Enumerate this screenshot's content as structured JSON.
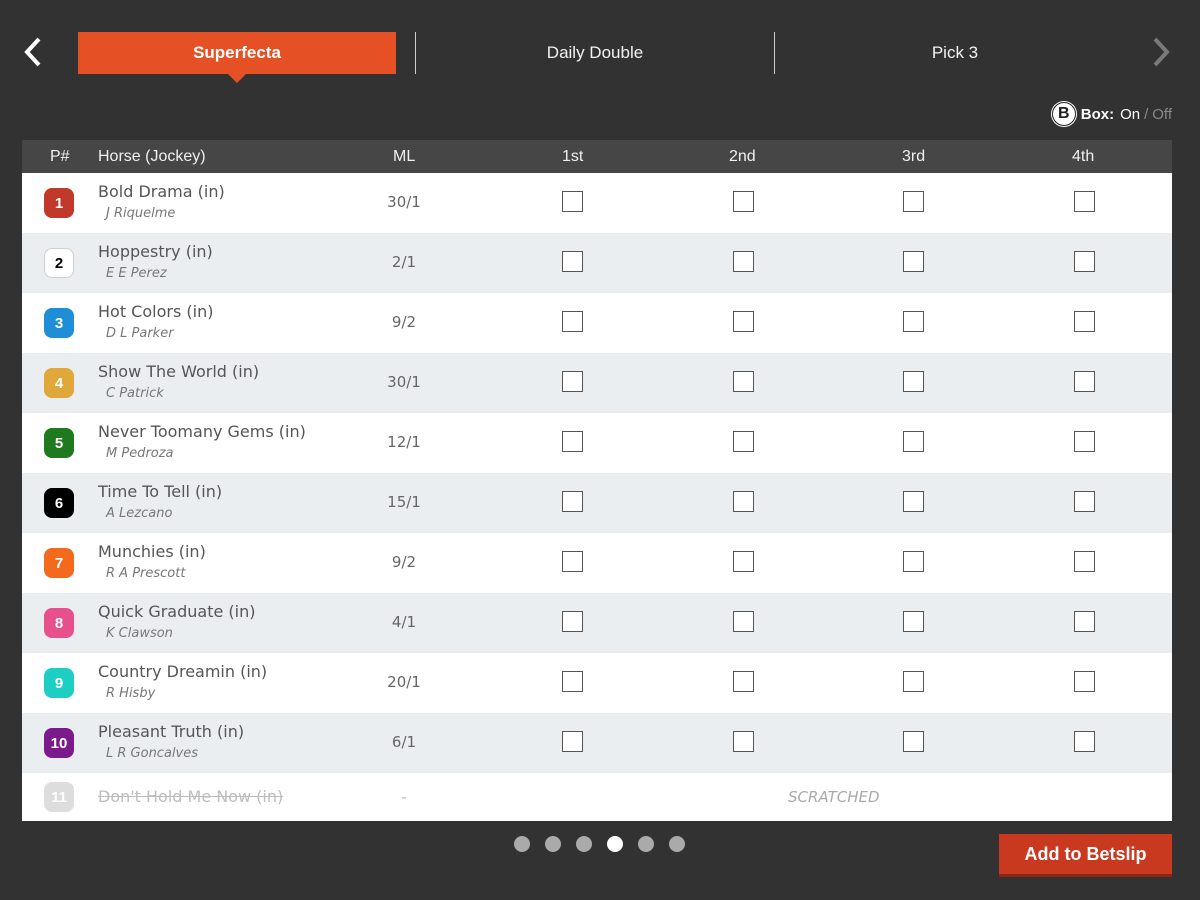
{
  "nav": {
    "tabs": [
      {
        "label": "Superfecta",
        "active": true
      },
      {
        "label": "Daily Double",
        "active": false
      },
      {
        "label": "Pick 3",
        "active": false
      }
    ],
    "prev_icon": "chevron-left-icon",
    "next_icon": "chevron-right-icon"
  },
  "box_toggle": {
    "badge": "B",
    "label": "Box:",
    "on": "On",
    "separator": "/",
    "off": "Off",
    "state": "On"
  },
  "table": {
    "headers": {
      "pnum": "P#",
      "horse": "Horse (Jockey)",
      "ml": "ML",
      "first": "1st",
      "second": "2nd",
      "third": "3rd",
      "fourth": "4th"
    },
    "rows": [
      {
        "num": "1",
        "horse": "Bold Drama (in)",
        "jockey": "J Riquelme",
        "ml": "30/1",
        "saddle_color": "#c0392b",
        "text_color": "#ffffff"
      },
      {
        "num": "2",
        "horse": "Hoppestry (in)",
        "jockey": "E E Perez",
        "ml": "2/1",
        "saddle_color": "#ffffff",
        "text_color": "#000000"
      },
      {
        "num": "3",
        "horse": "Hot Colors (in)",
        "jockey": "D L Parker",
        "ml": "9/2",
        "saddle_color": "#1e8fd6",
        "text_color": "#ffffff"
      },
      {
        "num": "4",
        "horse": "Show The World (in)",
        "jockey": "C Patrick",
        "ml": "30/1",
        "saddle_color": "#e0a83a",
        "text_color": "#ffffff"
      },
      {
        "num": "5",
        "horse": "Never Toomany Gems (in)",
        "jockey": "M Pedroza",
        "ml": "12/1",
        "saddle_color": "#1f7a1f",
        "text_color": "#ffffff"
      },
      {
        "num": "6",
        "horse": "Time To Tell (in)",
        "jockey": "A Lezcano",
        "ml": "15/1",
        "saddle_color": "#000000",
        "text_color": "#ffffff"
      },
      {
        "num": "7",
        "horse": "Munchies (in)",
        "jockey": "R A Prescott",
        "ml": "9/2",
        "saddle_color": "#f36a1d",
        "text_color": "#ffffff"
      },
      {
        "num": "8",
        "horse": "Quick Graduate (in)",
        "jockey": "K Clawson",
        "ml": "4/1",
        "saddle_color": "#e8508c",
        "text_color": "#ffffff"
      },
      {
        "num": "9",
        "horse": "Country Dreamin (in)",
        "jockey": "R Hisby",
        "ml": "20/1",
        "saddle_color": "#1ccfc2",
        "text_color": "#ffffff"
      },
      {
        "num": "10",
        "horse": "Pleasant Truth (in)",
        "jockey": "L R Goncalves",
        "ml": "6/1",
        "saddle_color": "#7b1a8a",
        "text_color": "#ffffff"
      }
    ],
    "scratched": {
      "num": "11",
      "horse": "Don't Hold Me Now (in)",
      "ml": "-",
      "label": "SCRATCHED",
      "saddle_color": "#dddddd",
      "text_color": "#ffffff"
    }
  },
  "pager": {
    "count": 6,
    "active_index": 3
  },
  "actions": {
    "add_to_betslip": "Add to Betslip"
  }
}
